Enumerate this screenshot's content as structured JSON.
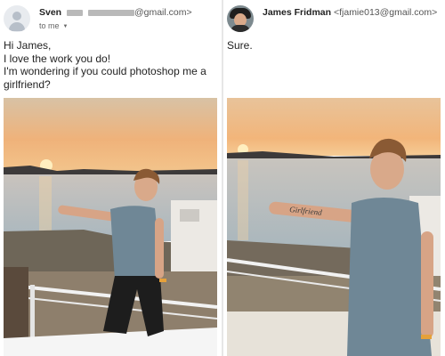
{
  "left_email": {
    "sender_name": "Sven",
    "sender_email_suffix": "@gmail.com>",
    "to_label": "to me",
    "body": "Hi James,\nI love the work you do!\nI'm wondering if you could photoshop me a girlfriend?"
  },
  "right_email": {
    "sender_name": "James Fridman",
    "sender_email": "<fjamie013@gmail.com>",
    "body": "Sure.",
    "tattoo_text": "Girlfriend"
  },
  "colors": {
    "sky_top": "#e9c69b",
    "sun": "#ffe7a3",
    "sea": "#b9c6cc",
    "shirt": "#6f8796"
  },
  "icons": {
    "left_avatar": "default-person-icon",
    "right_avatar": "profile-photo",
    "to_dropdown": "chevron-down-icon"
  }
}
